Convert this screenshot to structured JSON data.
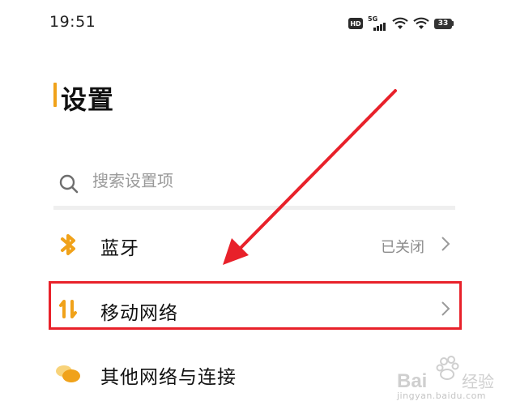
{
  "status_bar": {
    "time": "19:51",
    "hd": "HD",
    "network": "5G",
    "battery": "33"
  },
  "page": {
    "title": "设置",
    "accent_color": "#f0a21a"
  },
  "search": {
    "placeholder": "搜索设置项",
    "icon": "search-icon"
  },
  "items": [
    {
      "label": "蓝牙",
      "value": "已关闭",
      "icon": "bluetooth-icon"
    },
    {
      "label": "移动网络",
      "value": "",
      "icon": "mobile-data-icon"
    },
    {
      "label": "其他网络与连接",
      "value": "",
      "icon": "other-connections-icon"
    }
  ],
  "annotation": {
    "highlight_color": "#e8212a",
    "arrow_color": "#e8212a"
  },
  "watermark": {
    "text": "jingyan.baidu.com",
    "logo_text": "Bai经验"
  }
}
